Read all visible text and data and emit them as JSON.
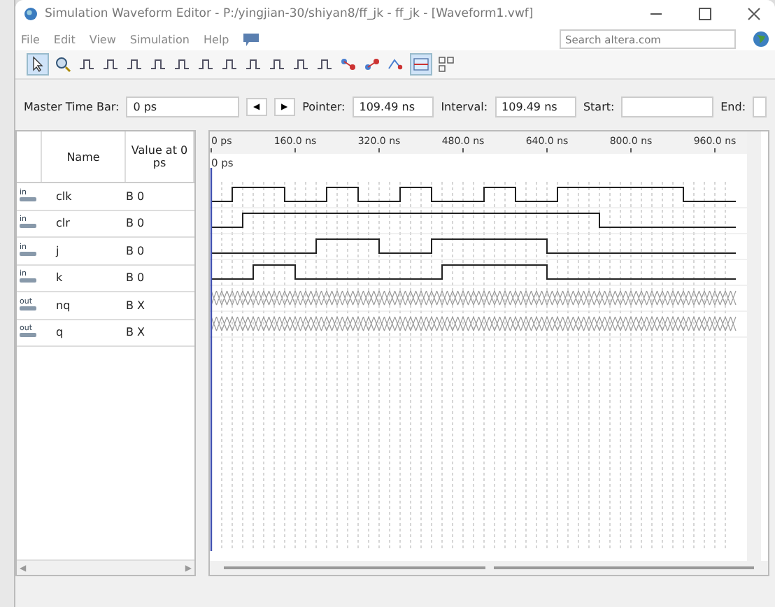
{
  "window": {
    "title": "Simulation Waveform Editor - P:/yingjian-30/shiyan8/ff_jk - ff_jk - [Waveform1.vwf]"
  },
  "menu": [
    "File",
    "Edit",
    "View",
    "Simulation",
    "Help"
  ],
  "search": {
    "placeholder": "Search altera.com"
  },
  "time_bar": {
    "master_label": "Master Time Bar:",
    "master_value": "0 ps",
    "prev": "◀",
    "next": "▶",
    "pointer_label": "Pointer:",
    "pointer_value": "109.49 ns",
    "interval_label": "Interval:",
    "interval_value": "109.49 ns",
    "start_label": "Start:",
    "end_label": "End:"
  },
  "table": {
    "columns": [
      "Name",
      "Value at 0 ps"
    ],
    "rows": [
      {
        "direction": "in",
        "name": "clk",
        "value": "B 0"
      },
      {
        "direction": "in",
        "name": "clr",
        "value": "B 0"
      },
      {
        "direction": "in",
        "name": "j",
        "value": "B 0"
      },
      {
        "direction": "in",
        "name": "k",
        "value": "B 0"
      },
      {
        "direction": "out",
        "name": "nq",
        "value": "B X"
      },
      {
        "direction": "out",
        "name": "q",
        "value": "B X"
      }
    ],
    "scroll_left": "◀",
    "scroll_right": "▶"
  },
  "waveform": {
    "ruler_labels": [
      "0 ps",
      "160.0 ns",
      "320.0 ns",
      "480.0 ns",
      "640.0 ns",
      "800.0 ns",
      "960.0 ns"
    ],
    "marker_label": "0 ps"
  }
}
